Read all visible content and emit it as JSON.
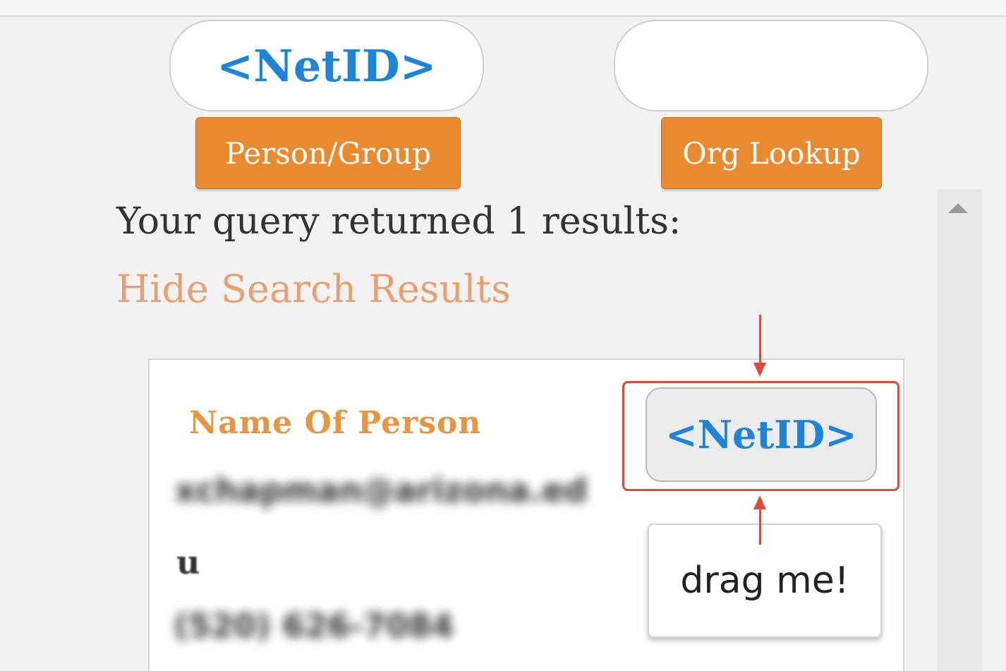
{
  "search": {
    "netid_value": "<NetID>",
    "org_value": "",
    "person_group_button": "Person/Group",
    "org_lookup_button": "Org Lookup"
  },
  "results": {
    "summary": "Your query returned 1 results:",
    "hide_link": "Hide Search Results",
    "card": {
      "name": "Name Of Person",
      "email_line1": "xchapman@arizona.ed",
      "email_line2": "u",
      "phone": "(520) 626-7084",
      "netid_tag": "<NetID>",
      "drag_label": "drag me!"
    }
  },
  "colors": {
    "accent_orange": "#e98a2f",
    "link_orange": "#e8a070",
    "netid_blue": "#1d84d8",
    "annotation_red": "#e04a3a"
  }
}
